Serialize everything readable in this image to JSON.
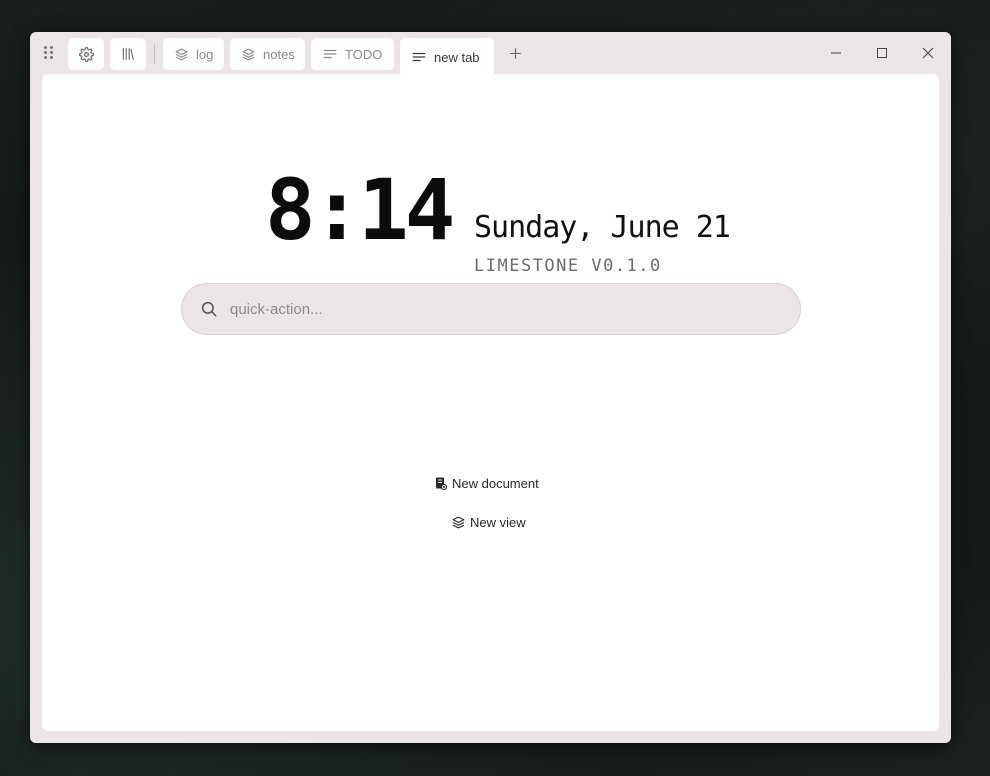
{
  "titlebar": {
    "icons": {
      "grip": "drag-grip-icon",
      "settings": "gear-icon",
      "library": "library-icon"
    },
    "tabs": [
      {
        "label": "log",
        "icon": "layers-icon",
        "active": false
      },
      {
        "label": "notes",
        "icon": "layers-icon",
        "active": false
      },
      {
        "label": "TODO",
        "icon": "lines-icon",
        "active": false
      },
      {
        "label": "new tab",
        "icon": "lines-icon",
        "active": true
      }
    ],
    "new_tab_icon": "plus-icon",
    "window_controls": [
      "minimize-icon",
      "maximize-icon",
      "close-icon"
    ]
  },
  "home": {
    "time": "8:14",
    "date": "Sunday, June 21",
    "version": "LIMESTONE V0.1.0"
  },
  "search": {
    "placeholder": "quick-action...",
    "value": "",
    "icon": "search-icon"
  },
  "actions": [
    {
      "label": "New document",
      "icon": "new-document-icon"
    },
    {
      "label": "New view",
      "icon": "layers-icon"
    }
  ],
  "colors": {
    "window_bg": "#ebe5e6",
    "content_bg": "#ffffff",
    "tab_text": "#8d8788",
    "active_tab_text": "#3b3738",
    "clock_text": "#0c0c0c",
    "version_text": "#6e6a6b"
  }
}
